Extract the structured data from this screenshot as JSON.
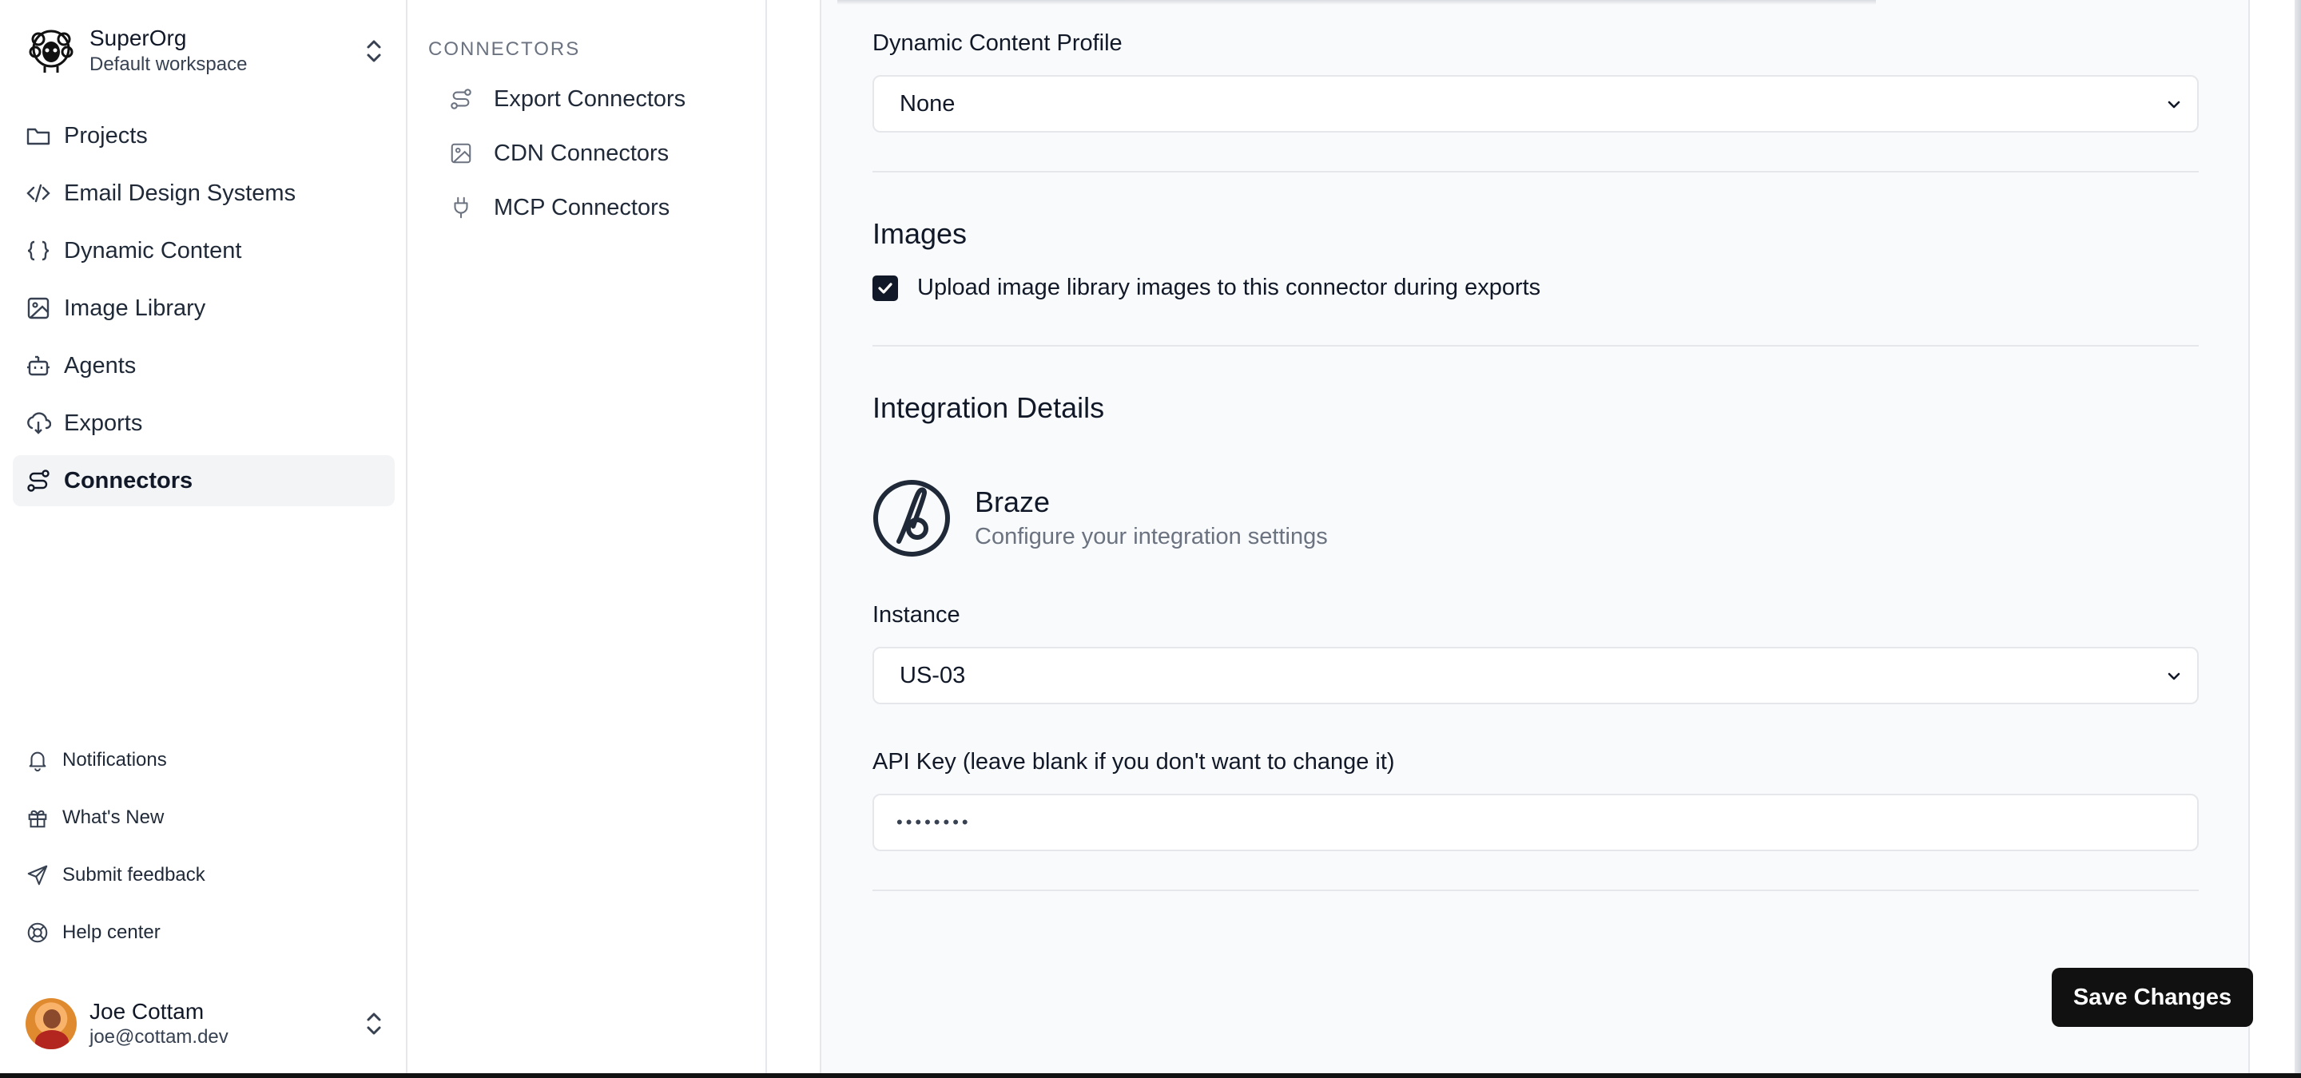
{
  "org": {
    "name": "SuperOrg",
    "workspace": "Default workspace"
  },
  "nav": {
    "items": [
      {
        "label": "Projects",
        "icon": "folder-icon"
      },
      {
        "label": "Email Design Systems",
        "icon": "code-icon"
      },
      {
        "label": "Dynamic Content",
        "icon": "braces-icon"
      },
      {
        "label": "Image Library",
        "icon": "image-icon"
      },
      {
        "label": "Agents",
        "icon": "bot-icon"
      },
      {
        "label": "Exports",
        "icon": "cloud-download-icon"
      },
      {
        "label": "Connectors",
        "icon": "route-icon",
        "active": true
      }
    ],
    "bottom": [
      {
        "label": "Notifications",
        "icon": "bell-icon"
      },
      {
        "label": "What's New",
        "icon": "gift-icon"
      },
      {
        "label": "Submit feedback",
        "icon": "send-icon"
      },
      {
        "label": "Help center",
        "icon": "life-buoy-icon"
      }
    ]
  },
  "user": {
    "name": "Joe Cottam",
    "email": "joe@cottam.dev"
  },
  "subnav": {
    "title": "CONNECTORS",
    "items": [
      {
        "label": "Export Connectors",
        "icon": "route-icon"
      },
      {
        "label": "CDN Connectors",
        "icon": "image-icon"
      },
      {
        "label": "MCP Connectors",
        "icon": "plug-icon"
      }
    ]
  },
  "form": {
    "dynamic_content_label": "Dynamic Content Profile",
    "dynamic_content_value": "None",
    "images_title": "Images",
    "upload_checkbox_label": "Upload image library images to this connector during exports",
    "upload_checked": true,
    "integration_title": "Integration Details",
    "integration_name": "Braze",
    "integration_desc": "Configure your integration settings",
    "instance_label": "Instance",
    "instance_value": "US-03",
    "api_key_label": "API Key (leave blank if you don't want to change it)",
    "api_key_value": "••••••••",
    "save_label": "Save Changes"
  }
}
